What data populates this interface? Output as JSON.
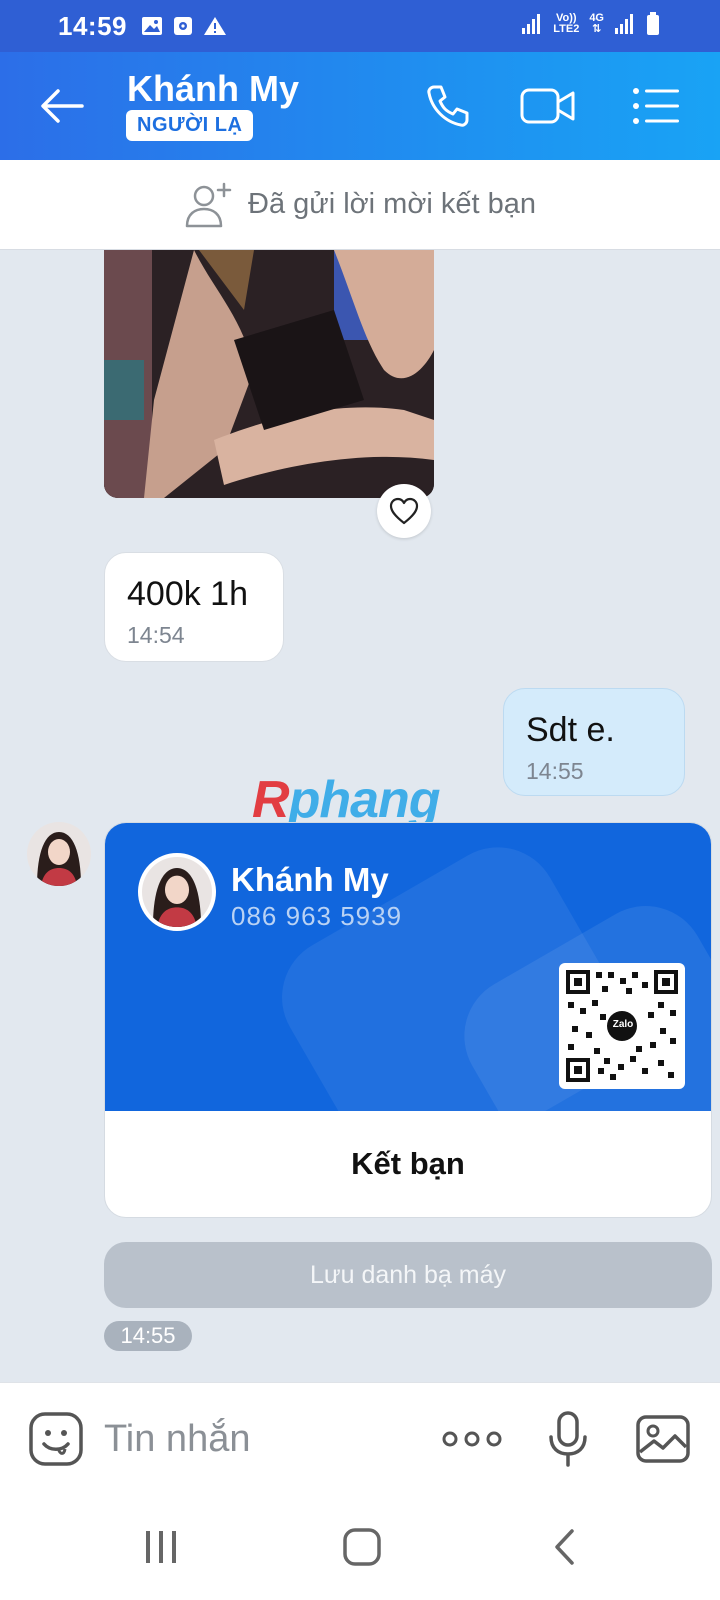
{
  "status_bar": {
    "time": "14:59",
    "network_line1": "Vo))",
    "network_line2": "LTE2",
    "network_4g": "4G"
  },
  "header": {
    "name": "Khánh My",
    "badge": "NGƯỜI LẠ"
  },
  "friend_request": {
    "text": "Đã gửi lời mời kết bạn"
  },
  "messages": {
    "incoming": {
      "text": "400k 1h",
      "time": "14:54"
    },
    "outgoing": {
      "text": "Sdt e.",
      "time": "14:55"
    }
  },
  "watermark": {
    "first": "R",
    "rest": "phang"
  },
  "contact_card": {
    "name": "Khánh My",
    "phone": "086 963 5939",
    "qr_logo": "Zalo",
    "add_friend_label": "Kết bạn"
  },
  "save_contact_label": "Lưu danh bạ máy",
  "card_time": "14:55",
  "input": {
    "placeholder": "Tin nhắn"
  },
  "colors": {
    "header_start": "#2c6ee8",
    "header_end": "#19a3f5",
    "card_blue": "#1166dd",
    "outgoing_bubble": "#d4ebfb"
  },
  "icons": [
    "back-arrow-icon",
    "phone-icon",
    "video-call-icon",
    "menu-list-icon",
    "add-friend-icon",
    "heart-icon",
    "emoji-icon",
    "more-icon",
    "microphone-icon",
    "image-icon"
  ]
}
